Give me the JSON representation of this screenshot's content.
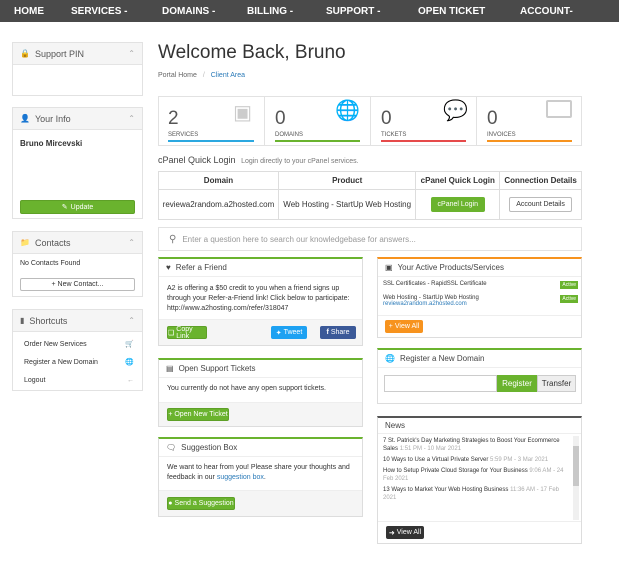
{
  "nav": {
    "items": [
      "HOME",
      "SERVICES -",
      "DOMAINS -",
      "BILLING -",
      "SUPPORT -",
      "OPEN TICKET",
      "ACCOUNT-"
    ]
  },
  "sidebar": {
    "support_pin": {
      "title": "Support PIN"
    },
    "your_info": {
      "title": "Your Info",
      "name": "Bruno Mircevski",
      "update_label": "Update"
    },
    "contacts": {
      "title": "Contacts",
      "empty_text": "No Contacts Found",
      "new_label": "+ New Contact..."
    },
    "shortcuts": {
      "title": "Shortcuts",
      "items": [
        "Order New Services",
        "Register a New Domain",
        "Logout"
      ]
    }
  },
  "main": {
    "welcome": "Welcome Back, Bruno",
    "breadcrumb": {
      "home": "Portal Home",
      "sep": "/",
      "current": "Client Area"
    },
    "stats": [
      {
        "value": "2",
        "label": "SERVICES",
        "color": "#2ba8e0"
      },
      {
        "value": "0",
        "label": "DOMAINS",
        "color": "#6ab32e"
      },
      {
        "value": "0",
        "label": "TICKETS",
        "color": "#e64a4a"
      },
      {
        "value": "0",
        "label": "INVOICES",
        "color": "#f7931e"
      }
    ],
    "quick_login": {
      "title": "cPanel Quick Login",
      "subtitle": "Login directly to your cPanel services.",
      "headers": [
        "Domain",
        "Product",
        "cPanel Quick Login",
        "Connection Details"
      ],
      "row": {
        "domain": "reviewa2random.a2hosted.com",
        "product": "Web Hosting - StartUp Web Hosting",
        "login_label": "cPanel Login",
        "details_label": "Account Details"
      }
    },
    "kb_search": {
      "placeholder": "Enter a question here to search our knowledgebase for answers..."
    },
    "refer": {
      "title": "Refer a Friend",
      "text": "A2 is offering a $50 credit to you when a friend signs up through your Refer-a-Friend link! Click below to participate:",
      "link": "http://www.a2hosting.com/refer/318047",
      "copy_label": "Copy Link",
      "tweet_label": "Tweet",
      "share_label": "Share"
    },
    "tickets": {
      "title": "Open Support Tickets",
      "text": "You currently do not have any open support tickets.",
      "button_label": "+ Open New Ticket"
    },
    "suggestion": {
      "title": "Suggestion Box",
      "text_a": "We want to hear from you! Please share your thoughts and feedback in our",
      "link": "suggestion box",
      "text_b": ".",
      "button_label": "Send a Suggestion"
    },
    "products": {
      "title": "Your Active Products/Services",
      "items": [
        {
          "name": "SSL Certificates - RapidSSL Certificate",
          "domain": "",
          "status": "Active"
        },
        {
          "name": "Web Hosting - StartUp Web Hosting",
          "domain": "reviewa2random.a2hosted.com",
          "status": "Active"
        }
      ],
      "view_all": "View All"
    },
    "register_domain": {
      "title": "Register a New Domain",
      "register_label": "Register",
      "transfer_label": "Transfer"
    },
    "news": {
      "title": "News",
      "items": [
        {
          "title": "7 St. Patrick's Day Marketing Strategies to Boost Your Ecommerce Sales",
          "date": "1:51 PM - 10 Mar 2021"
        },
        {
          "title": "10 Ways to Use a Virtual Private Server",
          "date": "5:59 PM - 3 Mar 2021"
        },
        {
          "title": "How to Setup Private Cloud Storage for Your Business",
          "date": "9:06 AM - 24 Feb 2021"
        },
        {
          "title": "13 Ways to Market Your Web Hosting Business",
          "date": "11:36 AM - 17 Feb 2021"
        }
      ],
      "view_all": "View All"
    }
  }
}
